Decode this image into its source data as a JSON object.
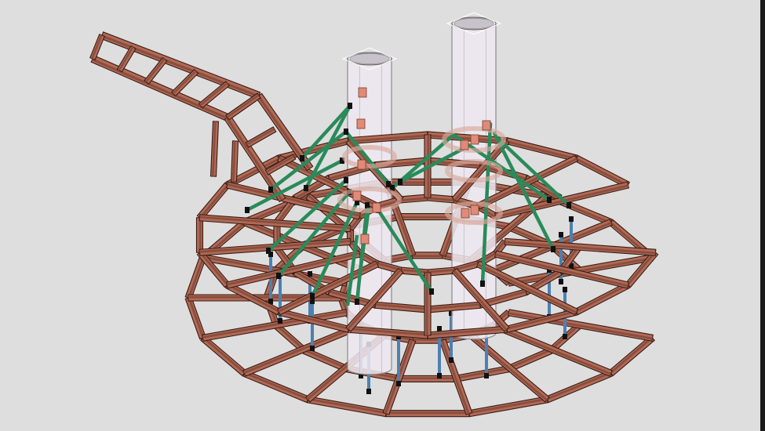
{
  "scene": {
    "background": "#dedede",
    "beam_color": "#8a4e3e",
    "beam_face_color": "#b06a56",
    "beam_edge_color": "#3b1c14",
    "cable_color": "#2a8a5a",
    "column_color": "#4f7fb0",
    "tower_fill": "#efe9f1",
    "tower_stroke": "#8a8a8a",
    "plate_color": "#e08a78",
    "frame_color": "#111111"
  }
}
